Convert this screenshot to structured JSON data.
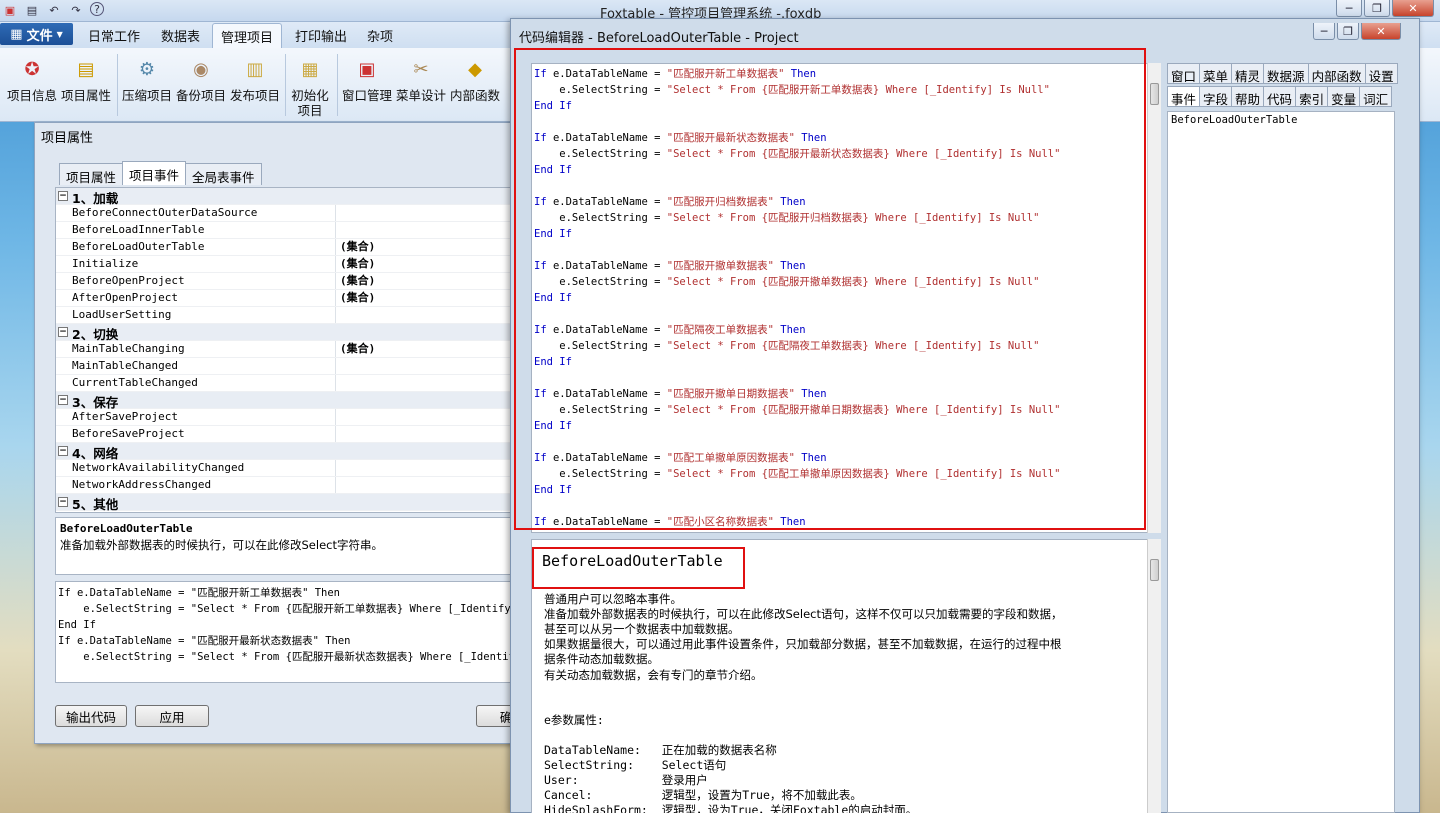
{
  "app": {
    "title": "Foxtable - 管控项目管理系统 -.foxdb"
  },
  "menu": {
    "file": "文件",
    "tabs": [
      "日常工作",
      "数据表",
      "管理项目",
      "打印输出",
      "杂项"
    ]
  },
  "ribbon": {
    "buttons": [
      "项目信息",
      "项目属性",
      "压缩项目",
      "备份项目",
      "发布项目",
      "初始化",
      "项目",
      "窗口管理",
      "菜单设计",
      "内部函数"
    ]
  },
  "dialog": {
    "title": "项目属性",
    "tabs": [
      "项目属性",
      "项目事件",
      "全局表事件"
    ],
    "rows": [
      {
        "cat": "1、加载"
      },
      {
        "name": "BeforeConnectOuterDataSource",
        "val": ""
      },
      {
        "name": "BeforeLoadInnerTable",
        "val": ""
      },
      {
        "name": "BeforeLoadOuterTable",
        "val": "(集合)"
      },
      {
        "name": "Initialize",
        "val": "(集合)"
      },
      {
        "name": "BeforeOpenProject",
        "val": "(集合)"
      },
      {
        "name": "AfterOpenProject",
        "val": "(集合)"
      },
      {
        "name": "LoadUserSetting",
        "val": ""
      },
      {
        "cat": "2、切换"
      },
      {
        "name": "MainTableChanging",
        "val": "(集合)"
      },
      {
        "name": "MainTableChanged",
        "val": ""
      },
      {
        "name": "CurrentTableChanged",
        "val": ""
      },
      {
        "cat": "3、保存"
      },
      {
        "name": "AfterSaveProject",
        "val": ""
      },
      {
        "name": "BeforeSaveProject",
        "val": ""
      },
      {
        "cat": "4、网络"
      },
      {
        "name": "NetworkAvailabilityChanged",
        "val": ""
      },
      {
        "name": "NetworkAddressChanged",
        "val": ""
      },
      {
        "cat": "5、其他"
      }
    ],
    "desc_title": "BeforeLoadOuterTable",
    "desc_text": "准备加载外部数据表的时候执行，可以在此修改Select字符串。",
    "code_lines": [
      "If e.DataTableName = \"匹配服开新工单数据表\" Then",
      "    e.SelectString = \"Select * From {匹配服开新工单数据表} Where [_Identify]",
      "End If",
      "",
      "If e.DataTableName = \"匹配服开最新状态数据表\" Then",
      "    e.SelectString = \"Select * From {匹配服开最新状态数据表} Where [_Identif"
    ],
    "buttons": {
      "export": "输出代码",
      "apply": "应用",
      "ok": "确"
    }
  },
  "editor": {
    "title": "代码编辑器 - BeforeLoadOuterTable - Project",
    "blocks": [
      {
        "name": "匹配服开新工单数据表"
      },
      {
        "name": "匹配服开最新状态数据表"
      },
      {
        "name": "匹配服开归档数据表"
      },
      {
        "name": "匹配服开撤单数据表"
      },
      {
        "name": "匹配隔夜工单数据表"
      },
      {
        "name": "匹配服开撤单日期数据表"
      },
      {
        "name": "匹配工单撤单原因数据表"
      }
    ],
    "last_line_name": "匹配小区名称数据表",
    "code_tokens": {
      "if": "If",
      "var": " e.DataTableName = ",
      "then": " Then",
      "sel": "    e.SelectString = ",
      "sel_a": "\"Select * From {",
      "sel_b": "} Where [_Identify] Is Null\"",
      "endif": "End If"
    },
    "help": {
      "title": "BeforeLoadOuterTable",
      "lines": [
        "普通用户可以忽略本事件。",
        "准备加载外部数据表的时候执行，可以在此修改Select语句，这样不仅可以只加载需要的字段和数据，",
        "甚至可以从另一个数据表中加载数据。",
        "如果数据量很大，可以通过用此事件设置条件，只加载部分数据，甚至不加载数据，在运行的过程中根",
        "据条件动态加载数据。",
        "有关动态加载数据，会有专门的章节介绍。",
        "",
        "",
        "e参数属性:",
        "",
        "DataTableName:   正在加载的数据表名称",
        "SelectString:    Select语句",
        "User:            登录用户",
        "Cancel:          逻辑型，设置为True，将不加载此表。",
        "HideSplashForm:  逻辑型，设为True，关闭Foxtable的启动封面。"
      ]
    },
    "right_tabs_row1": [
      "窗口",
      "菜单",
      "精灵",
      "数据源",
      "内部函数",
      "设置"
    ],
    "right_tabs_row2": [
      "事件",
      "字段",
      "帮助",
      "代码",
      "索引",
      "变量",
      "词汇"
    ],
    "event_item": "BeforeLoadOuterTable"
  }
}
